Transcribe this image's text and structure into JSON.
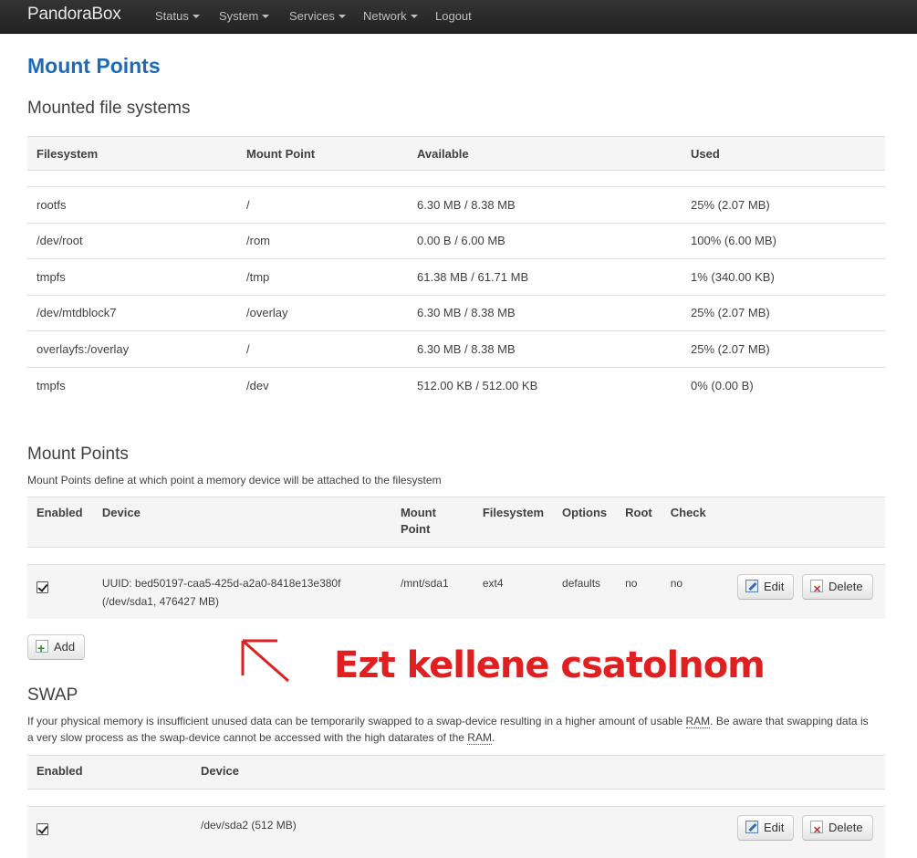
{
  "navbar": {
    "brand": "PandoraBox",
    "menu": [
      {
        "label": "Status",
        "dropdown": true
      },
      {
        "label": "System",
        "dropdown": true
      },
      {
        "label": "Services",
        "dropdown": true
      },
      {
        "label": "Network",
        "dropdown": true
      },
      {
        "label": "Logout",
        "dropdown": false
      }
    ]
  },
  "page_title": "Mount Points",
  "mounted": {
    "title": "Mounted file systems",
    "headers": [
      "Filesystem",
      "Mount Point",
      "Available",
      "Used"
    ],
    "rows": [
      [
        "rootfs",
        "/",
        "6.30 MB / 8.38 MB",
        "25% (2.07 MB)"
      ],
      [
        "/dev/root",
        "/rom",
        "0.00 B / 6.00 MB",
        "100% (6.00 MB)"
      ],
      [
        "tmpfs",
        "/tmp",
        "61.38 MB / 61.71 MB",
        "1% (340.00 KB)"
      ],
      [
        "/dev/mtdblock7",
        "/overlay",
        "6.30 MB / 8.38 MB",
        "25% (2.07 MB)"
      ],
      [
        "overlayfs:/overlay",
        "/",
        "6.30 MB / 8.38 MB",
        "25% (2.07 MB)"
      ],
      [
        "tmpfs",
        "/dev",
        "512.00 KB / 512.00 KB",
        "0% (0.00 B)"
      ]
    ]
  },
  "mount_points": {
    "title": "Mount Points",
    "description": "Mount Points define at which point a memory device will be attached to the filesystem",
    "headers": [
      "Enabled",
      "Device",
      "Mount Point",
      "Filesystem",
      "Options",
      "Root",
      "Check"
    ],
    "rows": [
      {
        "enabled": true,
        "device_line1": "UUID: bed50197-caa5-425d-a2a0-8418e13e380f",
        "device_line2": "(/dev/sda1, 476427 MB)",
        "mount_point": "/mnt/sda1",
        "filesystem": "ext4",
        "options": "defaults",
        "root": "no",
        "check": "no"
      }
    ],
    "add_label": "Add"
  },
  "buttons": {
    "edit": "Edit",
    "delete": "Delete"
  },
  "annotation": "Ezt kellene csatolnom",
  "swap": {
    "title": "SWAP",
    "desc_part1": "If your physical memory is insufficient unused data can be temporarily swapped to a swap-device resulting in a higher amount of usable ",
    "ram1": "RAM",
    "desc_part2": ". Be aware that swapping data is a very slow process as the swap-device cannot be accessed with the high datarates of the ",
    "ram2": "RAM",
    "desc_part3": ".",
    "headers": [
      "Enabled",
      "Device"
    ],
    "rows": [
      {
        "enabled": true,
        "device": "/dev/sda2 (512 MB)"
      }
    ]
  },
  "colors": {
    "accent": "#1c6bb7",
    "annotation": "#e02020",
    "navbar": "#222222"
  }
}
